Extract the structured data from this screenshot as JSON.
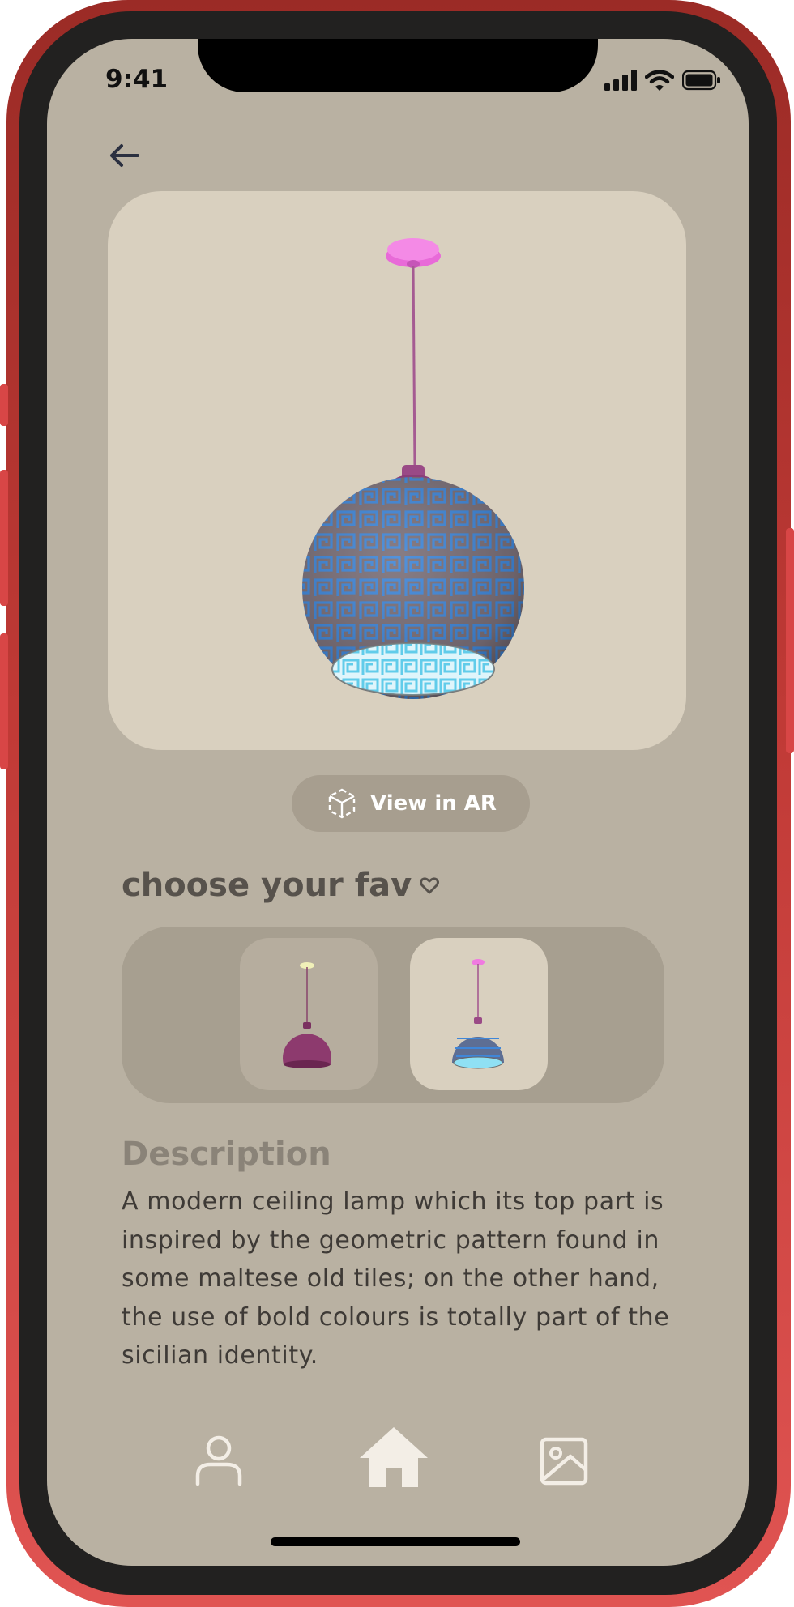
{
  "status_bar": {
    "time": "9:41"
  },
  "product": {
    "view_ar_label": "View in AR",
    "choose_title": "choose your fav",
    "variants": [
      {
        "name": "plum lamp",
        "color": "#8d3a6e"
      },
      {
        "name": "patterned lamp",
        "color": "#5d6e94"
      }
    ],
    "description_title": "Description",
    "description_text": "A modern ceiling lamp which its top part is inspired by the geometric pattern found in some maltese old tiles; on the other hand, the use of bold colours is totally part of the sicilian identity."
  },
  "nav": {
    "items": [
      "profile-icon",
      "home-icon",
      "gallery-icon"
    ]
  },
  "colors": {
    "screen_bg": "#b9b1a2",
    "card_bg": "#d9d0bf",
    "accent_pink": "#f07ae0",
    "lamp_blue": "#4f8ad0"
  }
}
